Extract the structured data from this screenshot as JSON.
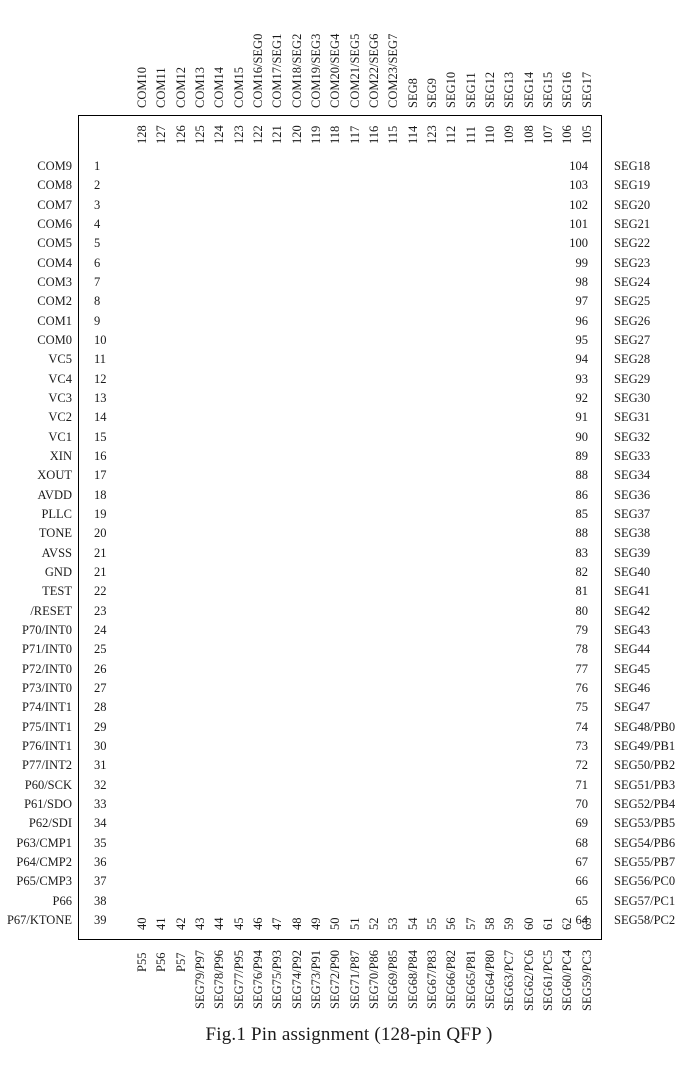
{
  "figure": {
    "caption": "Fig.1 Pin assignment (128-pin QFP )",
    "package": "128-pin QFP"
  },
  "left_side": {
    "pins": [
      {
        "num": "1",
        "name": "COM9"
      },
      {
        "num": "2",
        "name": "COM8"
      },
      {
        "num": "3",
        "name": "COM7"
      },
      {
        "num": "4",
        "name": "COM6"
      },
      {
        "num": "5",
        "name": "COM5"
      },
      {
        "num": "6",
        "name": "COM4"
      },
      {
        "num": "7",
        "name": "COM3"
      },
      {
        "num": "8",
        "name": "COM2"
      },
      {
        "num": "9",
        "name": "COM1"
      },
      {
        "num": "10",
        "name": "COM0"
      },
      {
        "num": "11",
        "name": "VC5"
      },
      {
        "num": "12",
        "name": "VC4"
      },
      {
        "num": "13",
        "name": "VC3"
      },
      {
        "num": "14",
        "name": "VC2"
      },
      {
        "num": "15",
        "name": "VC1"
      },
      {
        "num": "16",
        "name": "XIN"
      },
      {
        "num": "17",
        "name": "XOUT"
      },
      {
        "num": "18",
        "name": "AVDD"
      },
      {
        "num": "19",
        "name": "PLLC"
      },
      {
        "num": "20",
        "name": "TONE"
      },
      {
        "num": "21",
        "name": "AVSS"
      },
      {
        "num": "21",
        "name": "GND"
      },
      {
        "num": "22",
        "name": "TEST"
      },
      {
        "num": "23",
        "name": "/RESET"
      },
      {
        "num": "24",
        "name": "P70/INT0"
      },
      {
        "num": "25",
        "name": "P71/INT0"
      },
      {
        "num": "26",
        "name": "P72/INT0"
      },
      {
        "num": "27",
        "name": "P73/INT0"
      },
      {
        "num": "28",
        "name": "P74/INT1"
      },
      {
        "num": "29",
        "name": "P75/INT1"
      },
      {
        "num": "30",
        "name": "P76/INT1"
      },
      {
        "num": "31",
        "name": "P77/INT2"
      },
      {
        "num": "32",
        "name": "P60/SCK"
      },
      {
        "num": "33",
        "name": "P61/SDO"
      },
      {
        "num": "34",
        "name": "P62/SDI"
      },
      {
        "num": "35",
        "name": "P63/CMP1"
      },
      {
        "num": "36",
        "name": "P64/CMP2"
      },
      {
        "num": "37",
        "name": "P65/CMP3"
      },
      {
        "num": "38",
        "name": "P66"
      },
      {
        "num": "39",
        "name": "P67/KTONE"
      }
    ]
  },
  "right_side": {
    "pins": [
      {
        "num": "104",
        "name": "SEG18"
      },
      {
        "num": "103",
        "name": "SEG19"
      },
      {
        "num": "102",
        "name": "SEG20"
      },
      {
        "num": "101",
        "name": "SEG21"
      },
      {
        "num": "100",
        "name": "SEG22"
      },
      {
        "num": "99",
        "name": "SEG23"
      },
      {
        "num": "98",
        "name": "SEG24"
      },
      {
        "num": "97",
        "name": "SEG25"
      },
      {
        "num": "96",
        "name": "SEG26"
      },
      {
        "num": "95",
        "name": "SEG27"
      },
      {
        "num": "94",
        "name": "SEG28"
      },
      {
        "num": "93",
        "name": "SEG29"
      },
      {
        "num": "92",
        "name": "SEG30"
      },
      {
        "num": "91",
        "name": "SEG31"
      },
      {
        "num": "90",
        "name": "SEG32"
      },
      {
        "num": "89",
        "name": "SEG33"
      },
      {
        "num": "88",
        "name": "SEG34"
      },
      {
        "num": "86",
        "name": "SEG36"
      },
      {
        "num": "85",
        "name": "SEG37"
      },
      {
        "num": "88",
        "name": "SEG38"
      },
      {
        "num": "83",
        "name": "SEG39"
      },
      {
        "num": "82",
        "name": "SEG40"
      },
      {
        "num": "81",
        "name": "SEG41"
      },
      {
        "num": "80",
        "name": "SEG42"
      },
      {
        "num": "79",
        "name": "SEG43"
      },
      {
        "num": "78",
        "name": "SEG44"
      },
      {
        "num": "77",
        "name": "SEG45"
      },
      {
        "num": "76",
        "name": "SEG46"
      },
      {
        "num": "75",
        "name": "SEG47"
      },
      {
        "num": "74",
        "name": "SEG48/PB0"
      },
      {
        "num": "73",
        "name": "SEG49/PB1"
      },
      {
        "num": "72",
        "name": "SEG50/PB2"
      },
      {
        "num": "71",
        "name": "SEG51/PB3"
      },
      {
        "num": "70",
        "name": "SEG52/PB4"
      },
      {
        "num": "69",
        "name": "SEG53/PB5"
      },
      {
        "num": "68",
        "name": "SEG54/PB6"
      },
      {
        "num": "67",
        "name": "SEG55/PB7"
      },
      {
        "num": "66",
        "name": "SEG56/PC0"
      },
      {
        "num": "65",
        "name": "SEG57/PC1"
      },
      {
        "num": "64",
        "name": "SEG58/PC2"
      }
    ]
  },
  "top_side": {
    "pins": [
      {
        "num": "128",
        "name": "COM10"
      },
      {
        "num": "127",
        "name": "COM11"
      },
      {
        "num": "126",
        "name": "COM12"
      },
      {
        "num": "125",
        "name": "COM13"
      },
      {
        "num": "124",
        "name": "COM14"
      },
      {
        "num": "123",
        "name": "COM15"
      },
      {
        "num": "122",
        "name": "COM16/SEG0"
      },
      {
        "num": "121",
        "name": "COM17/SEG1"
      },
      {
        "num": "120",
        "name": "COM18/SEG2"
      },
      {
        "num": "119",
        "name": "COM19/SEG3"
      },
      {
        "num": "118",
        "name": "COM20/SEG4"
      },
      {
        "num": "117",
        "name": "COM21/SEG5"
      },
      {
        "num": "116",
        "name": "COM22/SEG6"
      },
      {
        "num": "115",
        "name": "COM23/SEG7"
      },
      {
        "num": "114",
        "name": "SEG8"
      },
      {
        "num": "123",
        "name": "SEG9"
      },
      {
        "num": "112",
        "name": "SEG10"
      },
      {
        "num": "111",
        "name": "SEG11"
      },
      {
        "num": "110",
        "name": "SEG12"
      },
      {
        "num": "109",
        "name": "SEG13"
      },
      {
        "num": "108",
        "name": "SEG14"
      },
      {
        "num": "107",
        "name": "SEG15"
      },
      {
        "num": "106",
        "name": "SEG16"
      },
      {
        "num": "105",
        "name": "SEG17"
      }
    ]
  },
  "bottom_side": {
    "pins": [
      {
        "num": "40",
        "name": "P55"
      },
      {
        "num": "41",
        "name": "P56"
      },
      {
        "num": "42",
        "name": "P57"
      },
      {
        "num": "43",
        "name": "SEG79/P97"
      },
      {
        "num": "44",
        "name": "SEG78/P96"
      },
      {
        "num": "45",
        "name": "SEG77/P95"
      },
      {
        "num": "46",
        "name": "SEG76/P94"
      },
      {
        "num": "47",
        "name": "SEG75/P93"
      },
      {
        "num": "48",
        "name": "SEG74/P92"
      },
      {
        "num": "49",
        "name": "SEG73/P91"
      },
      {
        "num": "50",
        "name": "SEG72/P90"
      },
      {
        "num": "51",
        "name": "SEG71/P87"
      },
      {
        "num": "52",
        "name": "SEG70/P86"
      },
      {
        "num": "53",
        "name": "SEG69/P85"
      },
      {
        "num": "54",
        "name": "SEG68/P84"
      },
      {
        "num": "55",
        "name": "SEG67/P83"
      },
      {
        "num": "56",
        "name": "SEG66/P82"
      },
      {
        "num": "57",
        "name": "SEG65/P81"
      },
      {
        "num": "58",
        "name": "SEG64/P80"
      },
      {
        "num": "59",
        "name": "SEG63/PC7"
      },
      {
        "num": "60",
        "name": "SEG62/PC6"
      },
      {
        "num": "61",
        "name": "SEG61/PC5"
      },
      {
        "num": "62",
        "name": "SEG60/PC4"
      },
      {
        "num": "63",
        "name": "SEG59/PC3"
      }
    ]
  }
}
